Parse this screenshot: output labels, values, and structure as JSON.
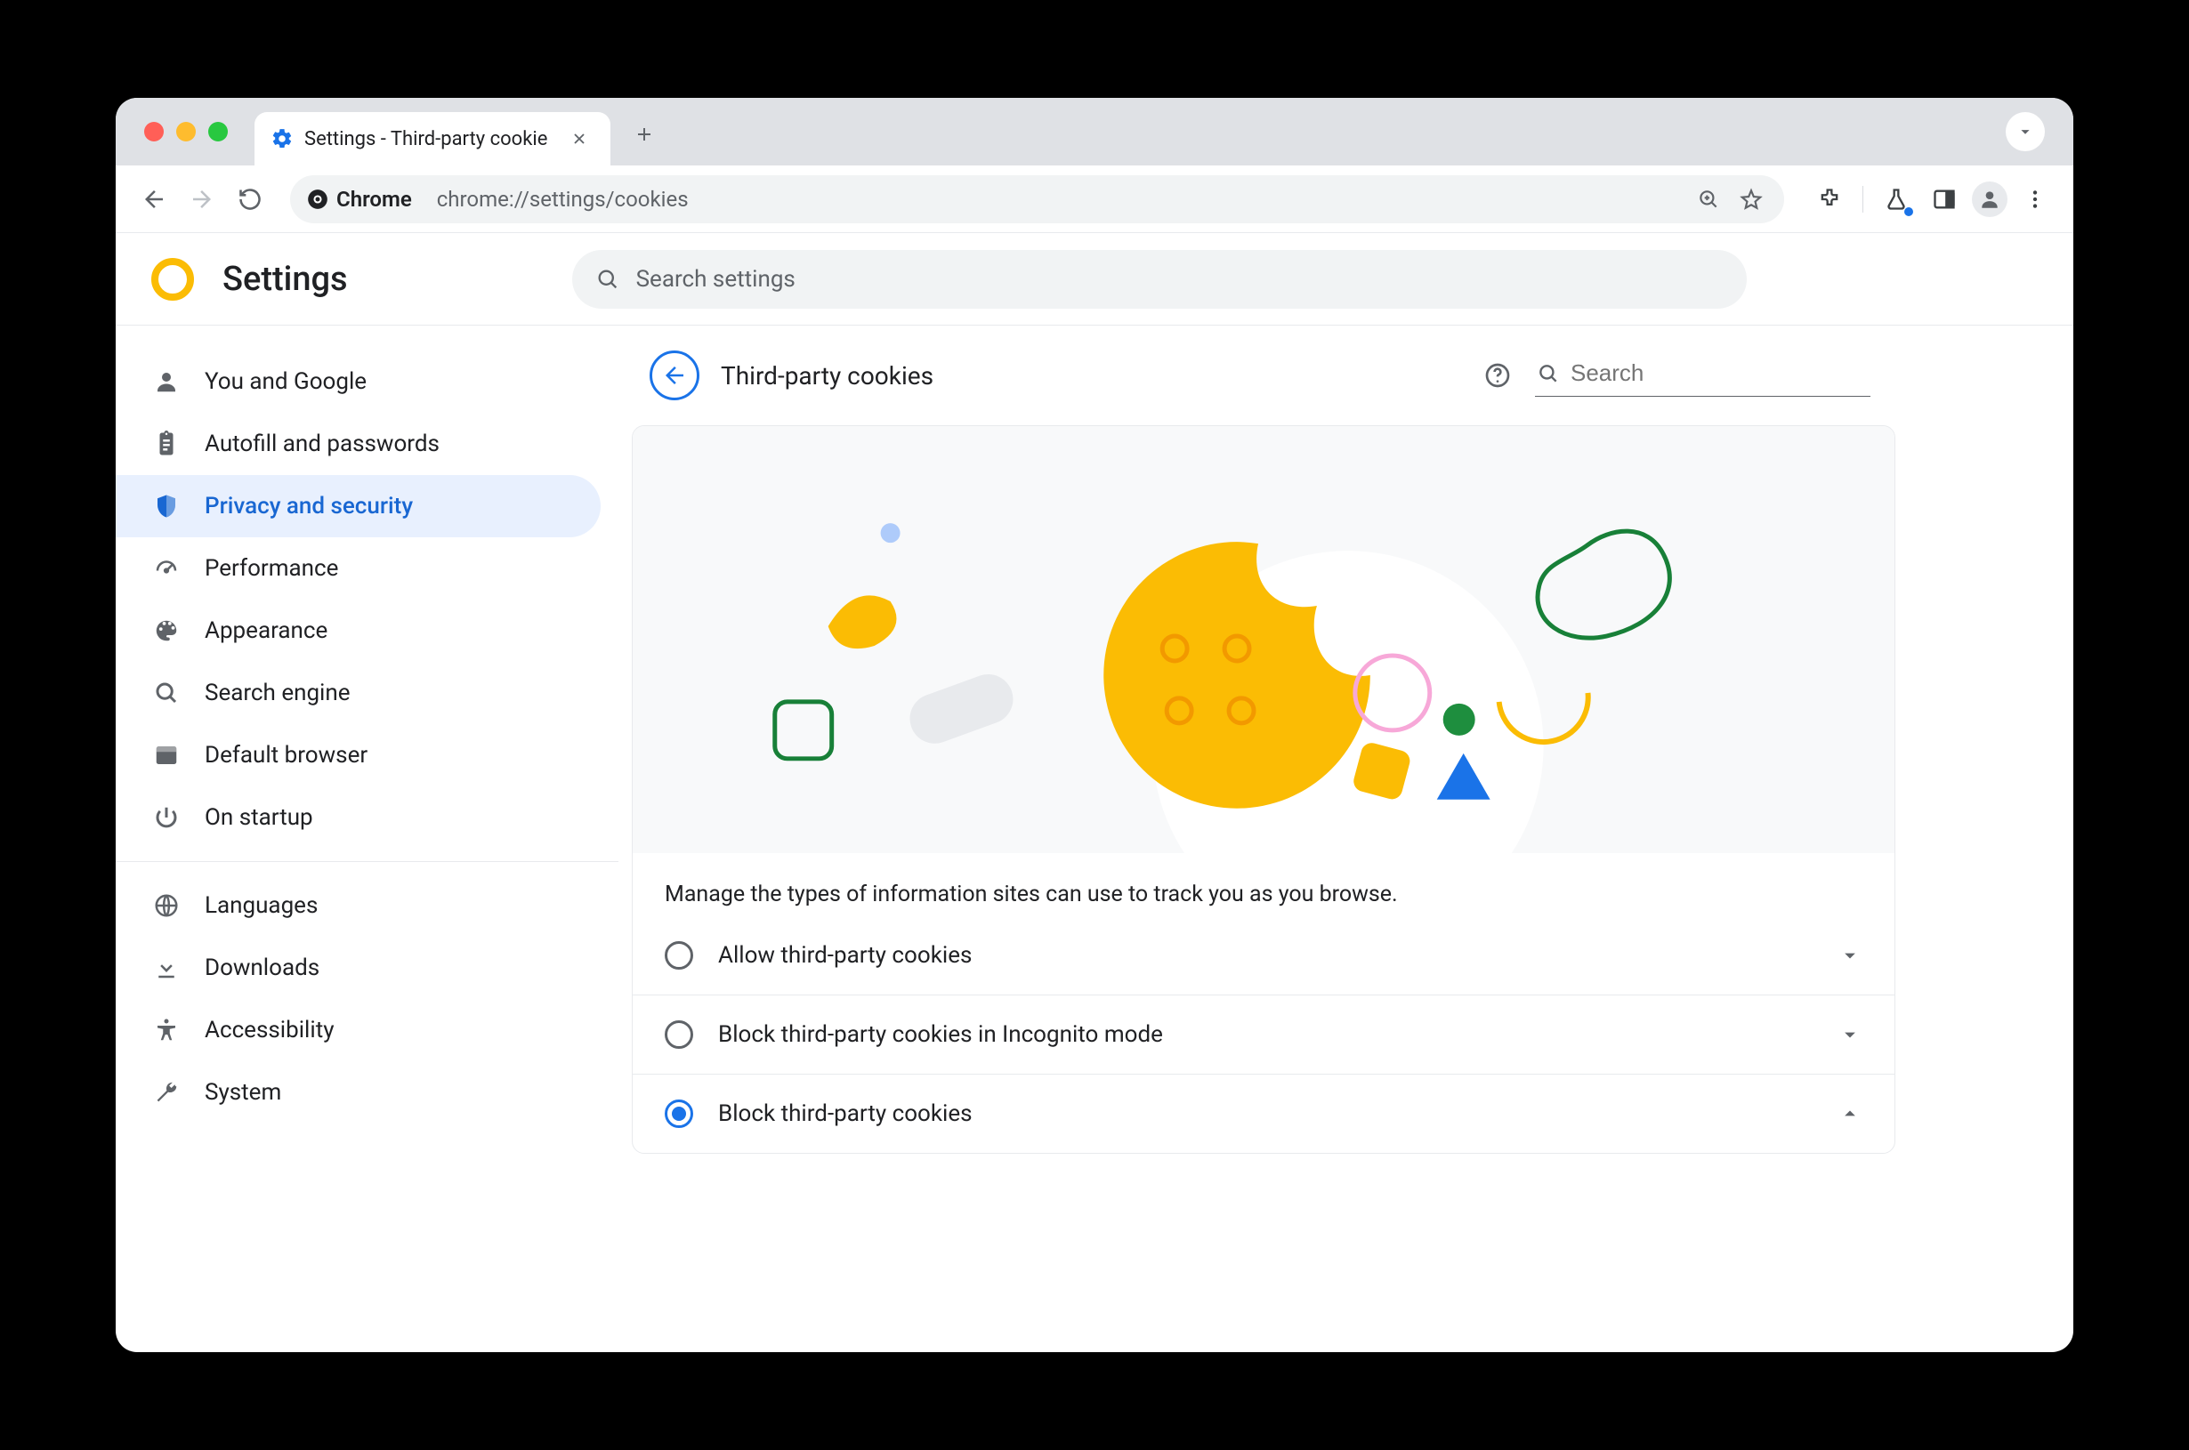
{
  "window": {
    "tab_title": "Settings - Third-party cookie",
    "url_chip": "Chrome",
    "url": "chrome://settings/cookies"
  },
  "header": {
    "app_title": "Settings",
    "search_placeholder": "Search settings"
  },
  "sidebar": {
    "items": [
      {
        "id": "you-and-google",
        "label": "You and Google"
      },
      {
        "id": "autofill",
        "label": "Autofill and passwords"
      },
      {
        "id": "privacy",
        "label": "Privacy and security"
      },
      {
        "id": "performance",
        "label": "Performance"
      },
      {
        "id": "appearance",
        "label": "Appearance"
      },
      {
        "id": "search-engine",
        "label": "Search engine"
      },
      {
        "id": "default-browser",
        "label": "Default browser"
      },
      {
        "id": "on-startup",
        "label": "On startup"
      }
    ],
    "items2": [
      {
        "id": "languages",
        "label": "Languages"
      },
      {
        "id": "downloads",
        "label": "Downloads"
      },
      {
        "id": "accessibility",
        "label": "Accessibility"
      },
      {
        "id": "system",
        "label": "System"
      }
    ],
    "active_id": "privacy"
  },
  "panel": {
    "title": "Third-party cookies",
    "search_placeholder": "Search",
    "description": "Manage the types of information sites can use to track you as you browse.",
    "options": [
      {
        "label": "Allow third-party cookies",
        "selected": false,
        "expanded": false
      },
      {
        "label": "Block third-party cookies in Incognito mode",
        "selected": false,
        "expanded": false
      },
      {
        "label": "Block third-party cookies",
        "selected": true,
        "expanded": true
      }
    ]
  },
  "colors": {
    "blue": "#1a73e8",
    "yellow": "#fbbc04",
    "green": "#188038",
    "grey_bg": "#f1f3f4"
  }
}
